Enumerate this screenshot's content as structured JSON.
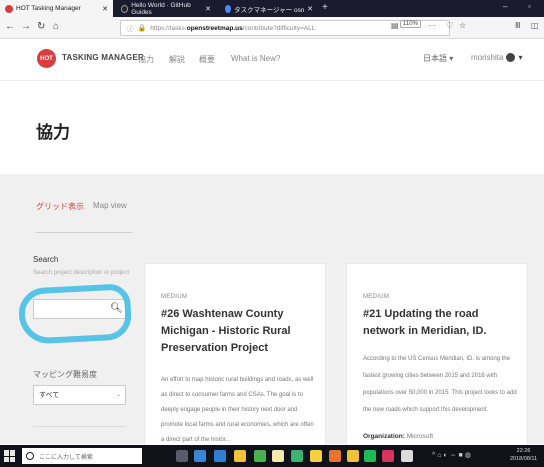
{
  "browser": {
    "tabs": [
      {
        "label": "HOT Tasking Manager",
        "active": true
      },
      {
        "label": "Hello World · GitHub Guides",
        "active": false
      },
      {
        "label": "タスクマネージャー osm - Google",
        "active": false
      }
    ],
    "new_tab": "+",
    "url_prefix": "https://tasks.",
    "url_domain": "openstreetmap.us",
    "url_path": "/contribute?difficulty=ALL",
    "zoom": "110%"
  },
  "site": {
    "logo_text": "HOT",
    "brand": "TASKING MANAGER",
    "menu": [
      "協力",
      "解説",
      "概要",
      "What is New?"
    ],
    "language": "日本語 ▾",
    "username": "morishita"
  },
  "page": {
    "title": "協力",
    "view_tabs": [
      "グリッド表示",
      "Map view"
    ]
  },
  "sidebar": {
    "search_label": "Search",
    "search_placeholder": "Search project description or project",
    "difficulty_label": "マッピング難易度",
    "difficulty_value": "すべて"
  },
  "projects": [
    {
      "level": "MEDIUM",
      "title": "#26 Washtenaw County Michigan - Historic Rural Preservation Project",
      "description_lines": [
        "An effort to map historic rural buildings and roads, as well",
        "as direct to consumer farms and CSAs. The goal is to",
        "deeply engage people in their history next door and",
        "promote local farms and rural economies, which are often",
        "a direct part of the histor..."
      ]
    },
    {
      "level": "MEDIUM",
      "title": "#21 Updating the road network in Meridian, ID.",
      "description_lines": [
        "According to the US Census Meridian, ID. is among the",
        "fastest growing cities between 2015 and 2016 with",
        "populations over 50,000 in 2015. This project looks to add",
        "the new roads which support this development."
      ],
      "org_label": "Organization:",
      "org_value": "Microsoft"
    }
  ],
  "taskbar": {
    "search_placeholder": "ここに入力して検索",
    "time": "22:26",
    "date": "2018/08/11"
  }
}
